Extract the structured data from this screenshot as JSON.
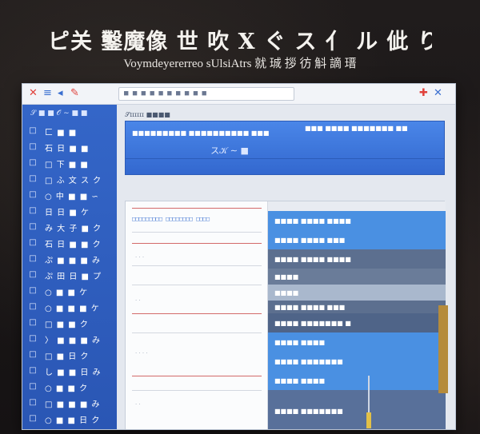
{
  "banner": {
    "title": "ピ关 鑿魔像 世 吹 X ぐ ス 亻 ル 佌 り 米 墻 ▸",
    "subtitle": "Voymdeyererreo sUlsiAtrs 就 珹 拶 彷 斛 謫 瑨"
  },
  "window": {
    "titlebar": {
      "search_text": "■ ■ ■ ■ ■ ■ ■ ■ ■ ■",
      "icons": {
        "close_left": "✕",
        "menu": "≡",
        "tool_1": "◂",
        "tool_2": "✎",
        "pin": "✚",
        "close_right": "✕"
      }
    },
    "sidebar": {
      "header": "𝒮 ■ ■ 𝒪 ∼ ■ ■",
      "items": [
        {
          "icon": "□",
          "label": "匚 ■ ■"
        },
        {
          "icon": "□",
          "label": "石 日 ■ ■"
        },
        {
          "icon": "□",
          "label": "□ 下 ■ ■"
        },
        {
          "icon": "□",
          "label": "□ ふ 文 ス ク"
        },
        {
          "icon": "□",
          "label": "○ 中 ■ ■ ∽"
        },
        {
          "icon": "□",
          "label": "日 日 ■ ケ"
        },
        {
          "icon": "□",
          "label": "み 大 子 ■ ク"
        },
        {
          "icon": "□",
          "label": "石 日 ■ ■ ク"
        },
        {
          "icon": "□",
          "label": "ぷ ■ ■ ■ み"
        },
        {
          "icon": "□",
          "label": "ぷ 田 日 ■ プ"
        },
        {
          "icon": "□",
          "label": "○ ■ ■ ケ"
        },
        {
          "icon": "□",
          "label": "○ ■ ■ ■ ケ"
        },
        {
          "icon": "□",
          "label": "□ ■ ■ ク"
        },
        {
          "icon": "□",
          "label": "〉 ■ ■ ■ み"
        },
        {
          "icon": "□",
          "label": "□ ■ 日 ク"
        },
        {
          "icon": "□",
          "label": "し ■ ■ 日 み"
        },
        {
          "icon": "□",
          "label": "○ ■ ■ ク"
        },
        {
          "icon": "□",
          "label": "□ ■ ■ ■ み"
        },
        {
          "icon": "□",
          "label": "○ ■ ■ 日 ク"
        }
      ]
    },
    "header_panel": {
      "strip": "𝒮ɪɪɪɪɪɪ ■■■■",
      "line1": "■■■■■■■■■ ■■■■■■■■■■ ■■■",
      "line2": "■■■ ■■■■ ■■■■■■■ ■■",
      "center": "ス𝒦 ∼ ■"
    },
    "doc": {
      "toolbar": "□□□□□□□□□ □□□□□□□□ □□□□",
      "texts": [
        "·  ·  ·",
        "· ·",
        "·  ·  ·  ·",
        "·  ·"
      ]
    },
    "rows": [
      {
        "label": "",
        "color": "#e8ebf1"
      },
      {
        "label": "■■■■ ■■■■ ■■■■",
        "color": "#4a90e2"
      },
      {
        "label": "■■■■ ■■■■ ■■■",
        "color": "#4a90e2"
      },
      {
        "label": "■■■■ ■■■■ ■■■■",
        "color": "#5c6f8f"
      },
      {
        "label": "■■■■",
        "color": "#6a7c99"
      },
      {
        "label": "■■■■",
        "color": "#a9b8cd"
      },
      {
        "label": "■■■■ ■■■■ ■■■",
        "color": "#5c6f8f"
      },
      {
        "label": "■■■■ ■■■■■■■ ■",
        "color": "#4f6488"
      },
      {
        "label": "■■■■ ■■■■",
        "color": "#4a90e2"
      },
      {
        "label": "■■■■ ■■■■■■■",
        "color": "#4a90e2"
      },
      {
        "label": "■■■■ ■■■■",
        "color": "#4a90e2"
      },
      {
        "label": "■■■■ ■■■■■■■",
        "color": "#58709a"
      }
    ]
  },
  "colors": {
    "sidebar": "#3466c8",
    "accent_blue": "#4a90e2",
    "accent_red": "#e0413b",
    "slate": "#5c6f8f"
  }
}
